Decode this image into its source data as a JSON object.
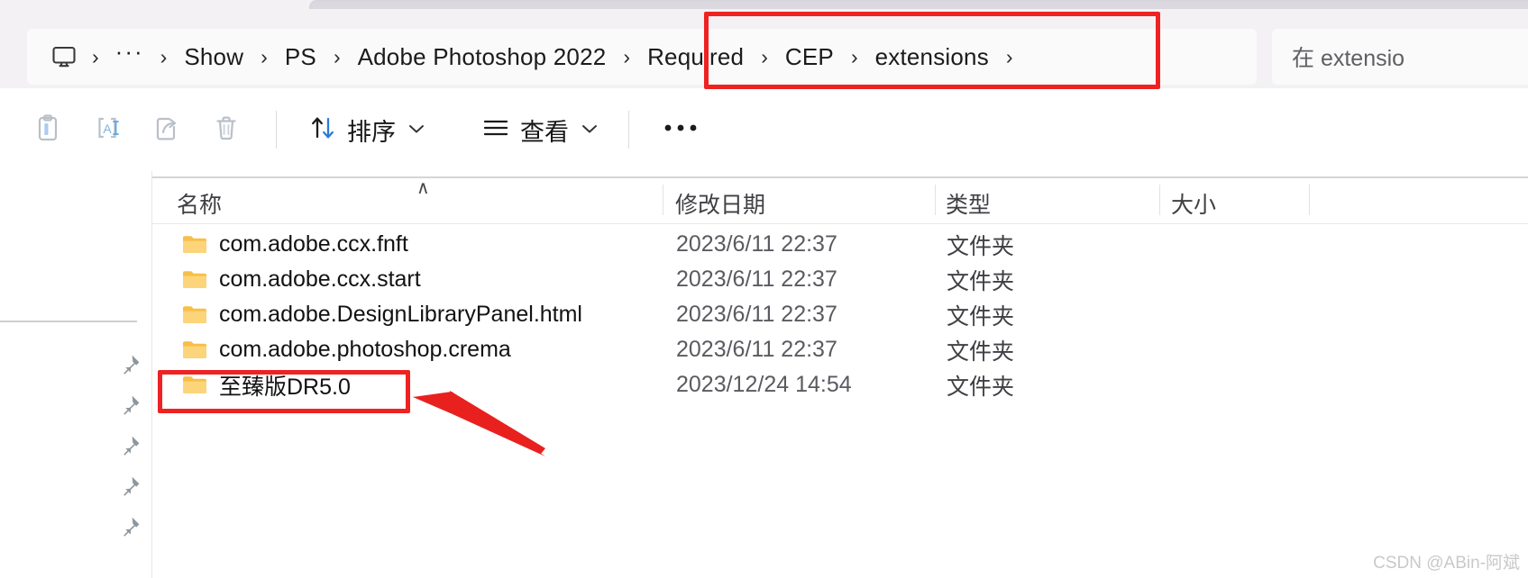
{
  "window": {
    "app": "File Explorer"
  },
  "address_bar": {
    "pc_icon": "monitor-icon",
    "overflow_label": "···",
    "crumbs": [
      {
        "label": "Show",
        "icon": null
      },
      {
        "label": "PS",
        "icon": null
      },
      {
        "label": "Adobe Photoshop 2022",
        "icon": null
      },
      {
        "label": "Required",
        "icon": null
      },
      {
        "label": "CEP",
        "icon": null
      },
      {
        "label": "extensions",
        "icon": null
      }
    ],
    "separator": "›"
  },
  "search": {
    "icon": "search-icon",
    "placeholder": "在 extensions 中搜索",
    "visible_text": "在 extensio"
  },
  "toolbar": {
    "icon_buttons": [
      {
        "name": "paste-button",
        "icon": "clipboard-paste-icon",
        "enabled": false
      },
      {
        "name": "rename-button",
        "icon": "rename-icon",
        "enabled": false
      },
      {
        "name": "share-button",
        "icon": "share-icon",
        "enabled": false
      },
      {
        "name": "delete-button",
        "icon": "trash-icon",
        "enabled": false
      }
    ],
    "sort": {
      "label": "排序",
      "icon": "sort-arrows-icon",
      "chevron": "⌄"
    },
    "view": {
      "label": "查看",
      "icon": "list-lines-icon",
      "chevron": "⌄"
    },
    "more": {
      "label": "···",
      "icon": "more-dots-icon"
    }
  },
  "nav_pane": {
    "pins": [
      {
        "icon": "pin-icon"
      },
      {
        "icon": "pin-icon"
      },
      {
        "icon": "pin-icon"
      },
      {
        "icon": "pin-icon"
      },
      {
        "icon": "pin-icon"
      }
    ]
  },
  "file_list": {
    "columns": [
      {
        "label": "名称",
        "sort": "asc",
        "sort_caret": "∧"
      },
      {
        "label": "修改日期",
        "sort": null
      },
      {
        "label": "类型",
        "sort": null
      },
      {
        "label": "大小",
        "sort": null
      }
    ],
    "rows": [
      {
        "name": "com.adobe.ccx.fnft",
        "date": "2023/6/11 22:37",
        "type": "文件夹",
        "size": "",
        "icon": "folder-icon",
        "highlighted": false
      },
      {
        "name": "com.adobe.ccx.start",
        "date": "2023/6/11 22:37",
        "type": "文件夹",
        "size": "",
        "icon": "folder-icon",
        "highlighted": false
      },
      {
        "name": "com.adobe.DesignLibraryPanel.html",
        "date": "2023/6/11 22:37",
        "type": "文件夹",
        "size": "",
        "icon": "folder-icon",
        "highlighted": false
      },
      {
        "name": "com.adobe.photoshop.crema",
        "date": "2023/6/11 22:37",
        "type": "文件夹",
        "size": "",
        "icon": "folder-icon",
        "highlighted": false
      },
      {
        "name": "至臻版DR5.0",
        "date": "2023/12/24 14:54",
        "type": "文件夹",
        "size": "",
        "icon": "folder-icon",
        "highlighted": true
      }
    ]
  },
  "annotations": {
    "color": "#ee2222",
    "boxes": [
      {
        "name": "breadcrumb-highlight",
        "targets": "Required › CEP › extensions"
      },
      {
        "name": "folder-highlight",
        "targets": "至臻版DR5.0"
      }
    ],
    "arrow": {
      "name": "pointer-arrow",
      "points_to": "至臻版DR5.0"
    }
  },
  "watermark": {
    "text": "CSDN @ABin-阿斌"
  },
  "colors": {
    "chrome_bg": "#f3f1f4",
    "field_bg": "#fbfafb",
    "content_bg": "#ffffff",
    "folder_yellow": "#fcc75b",
    "folder_yellow_dark": "#f5b63f",
    "accent_red": "#ee2222",
    "text_primary": "#121212",
    "text_secondary": "#5a5a60"
  }
}
